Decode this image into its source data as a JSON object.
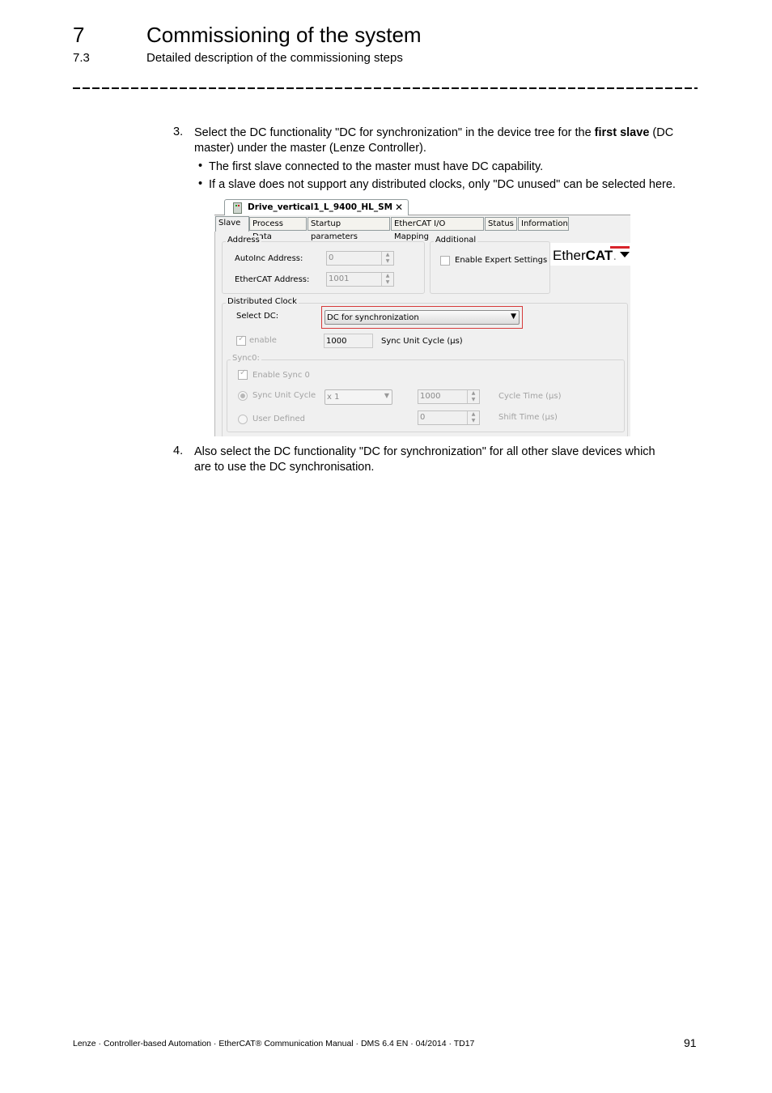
{
  "header": {
    "chapter_number": "7",
    "chapter_title": "Commissioning of the system",
    "section_number": "7.3",
    "section_title": "Detailed description of the commissioning steps"
  },
  "steps": [
    {
      "number": "3.",
      "text_before_bold": "Select the DC functionality \"DC for synchronization\" in the device tree for the ",
      "bold": "first slave",
      "text_after_bold": " (DC",
      "line2": "master) under the master (Lenze Controller).",
      "bullets": [
        "The first slave connected to the master must have DC capability.",
        "If a slave does not support any distributed clocks, only \"DC unused\" can be selected here."
      ]
    },
    {
      "number": "4.",
      "line1": "Also select the DC functionality \"DC for synchronization\" for all other slave devices which",
      "line2": "are to use the DC synchronisation."
    }
  ],
  "screenshot": {
    "document_tab": {
      "title": "Drive_vertical1_L_9400_HL_SM",
      "close_glyph": "✕",
      "icon": "device-icon"
    },
    "tabs": [
      "Slave",
      "Process Data",
      "Startup parameters",
      "EtherCAT I/O Mapping",
      "Status",
      "Information"
    ],
    "active_tab": "Slave",
    "address_group": {
      "label": "Address",
      "autoinc_label": "AutoInc Address:",
      "autoinc_value": "0",
      "ethercat_label": "EtherCAT Address:",
      "ethercat_value": "1001"
    },
    "additional_group": {
      "label": "Additional",
      "expert_settings_label": "Enable Expert Settings",
      "expert_settings_checked": false
    },
    "logo": {
      "text_light": "Ether",
      "text_bold": "CAT",
      "trademark": ".",
      "colors": {
        "arrow": "#d8232a"
      }
    },
    "distributed_clock": {
      "label": "Distributed Clock",
      "select_dc_label": "Select DC:",
      "select_dc_value": "DC for synchronization",
      "enable_label": "enable",
      "enable_checked": true,
      "sync_unit_cycle_value": "1000",
      "sync_unit_cycle_label": "Sync Unit Cycle (µs)"
    },
    "sync0": {
      "label": "Sync0:",
      "enable_sync0_label": "Enable Sync 0",
      "enable_sync0_checked": true,
      "sync_unit_cycle_radio_label": "Sync Unit Cycle",
      "sync_unit_cycle_selected": true,
      "multiplier_value": "x 1",
      "user_defined_label": "User Defined",
      "cycle_time_value": "1000",
      "cycle_time_label": "Cycle Time (µs)",
      "shift_time_value": "0",
      "shift_time_label": "Shift Time (µs)"
    },
    "highlight_color": "#d63a3a"
  },
  "footer": {
    "text": "Lenze · Controller-based Automation · EtherCAT® Communication Manual · DMS 6.4 EN · 04/2014 · TD17",
    "page_number": "91"
  }
}
